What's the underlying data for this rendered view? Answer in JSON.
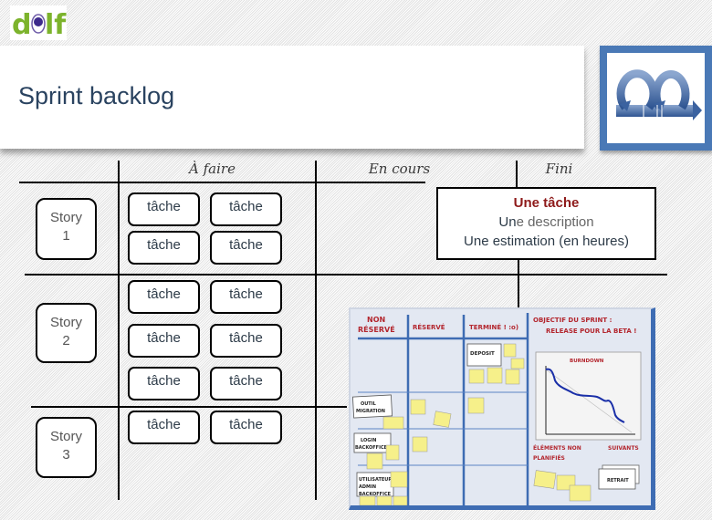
{
  "header": {
    "logo_text": "delf",
    "title": "Sprint backlog",
    "scrum_icon": "iteration-cycle-icon"
  },
  "board": {
    "columns": [
      "À faire",
      "En cours",
      "Fini"
    ],
    "stories": [
      {
        "line1": "Story",
        "line2": "1",
        "tasks": [
          "tâche",
          "tâche",
          "tâche",
          "tâche"
        ]
      },
      {
        "line1": "Story",
        "line2": "2",
        "tasks": [
          "tâche",
          "tâche",
          "tâche",
          "tâche",
          "tâche",
          "tâche"
        ]
      },
      {
        "line1": "Story",
        "line2": "3",
        "tasks": [
          "tâche",
          "tâche"
        ]
      }
    ]
  },
  "legend": {
    "title": "Une tâche",
    "description_bold": "Un",
    "description_rest": "e description",
    "estimation": "Une estimation (en heures)"
  },
  "photo_board": {
    "columns": [
      "NON RÉSERVÉ",
      "RÉSERVÉ",
      "TERMINÉ ! :o)"
    ],
    "objective_line1": "OBJECTIF DU SPRINT :",
    "objective_line2": "RELEASE POUR LA BETA !",
    "burndown_title": "BURNDOWN",
    "unplanned_label_line1": "ÉLÉMENTS NON",
    "unplanned_label_line2": "PLANIFIÉS",
    "next_label": "SUIVANTS",
    "stories": [
      "DEPOSIT",
      "OUTIL MIGRATION",
      "LOGIN BACKOFFICE",
      "UTILISATEUR ADMIN BACKOFFICE"
    ],
    "next_item": "RETRAIT",
    "colors": {
      "header_red": "#b3262e",
      "grid_blue": "#3e6cb3",
      "sticky_yellow": "#f6f08a",
      "burndown_line": "#1a2fa8"
    }
  }
}
